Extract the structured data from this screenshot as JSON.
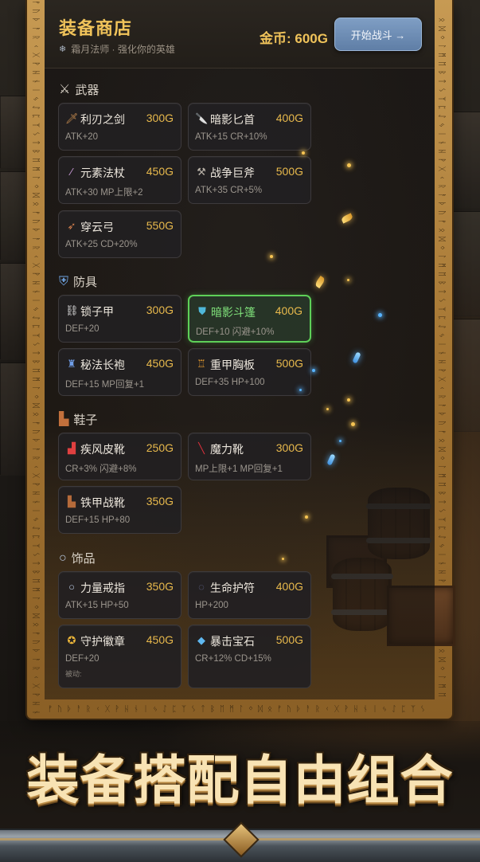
{
  "header": {
    "title": "装备商店",
    "subtitle": "霜月法师 · 强化你的英雄",
    "gold": "金币: 600G",
    "start_button": "开始战斗 →"
  },
  "sections": {
    "weapons": {
      "title": "武器",
      "icon": "crossed-swords-icon",
      "items": [
        {
          "name": "利刃之剑",
          "price": "300G",
          "stats": "ATK+20",
          "icon": "sword-icon"
        },
        {
          "name": "暗影匕首",
          "price": "400G",
          "stats": "ATK+15 CR+10%",
          "icon": "dagger-icon"
        },
        {
          "name": "元素法杖",
          "price": "450G",
          "stats": "ATK+30 MP上限+2",
          "icon": "wand-icon"
        },
        {
          "name": "战争巨斧",
          "price": "500G",
          "stats": "ATK+35 CR+5%",
          "icon": "axe-icon"
        },
        {
          "name": "穿云弓",
          "price": "550G",
          "stats": "ATK+25 CD+20%",
          "icon": "bow-icon"
        }
      ]
    },
    "armor": {
      "title": "防具",
      "icon": "shield-icon",
      "items": [
        {
          "name": "锁子甲",
          "price": "300G",
          "stats": "DEF+20",
          "icon": "chainmail-icon"
        },
        {
          "name": "暗影斗篷",
          "price": "400G",
          "stats": "DEF+10 闪避+10%",
          "icon": "cloak-icon",
          "selected": true
        },
        {
          "name": "秘法长袍",
          "price": "450G",
          "stats": "DEF+15 MP回复+1",
          "icon": "robe-icon"
        },
        {
          "name": "重甲胸板",
          "price": "500G",
          "stats": "DEF+35 HP+100",
          "icon": "breastplate-icon"
        }
      ]
    },
    "boots": {
      "title": "鞋子",
      "icon": "boot-icon",
      "items": [
        {
          "name": "疾风皮靴",
          "price": "250G",
          "stats": "CR+3% 闪避+8%",
          "icon": "sneaker-icon"
        },
        {
          "name": "魔力靴",
          "price": "300G",
          "stats": "MP上限+1 MP回复+1",
          "icon": "high-heel-icon"
        },
        {
          "name": "铁甲战靴",
          "price": "350G",
          "stats": "DEF+15 HP+80",
          "icon": "iron-boot-icon"
        }
      ]
    },
    "accessories": {
      "title": "饰品",
      "icon": "ring-icon",
      "items": [
        {
          "name": "力量戒指",
          "price": "350G",
          "stats": "ATK+15 HP+50",
          "icon": "ring-icon"
        },
        {
          "name": "生命护符",
          "price": "400G",
          "stats": "HP+200",
          "icon": "amulet-icon"
        },
        {
          "name": "守护徽章",
          "price": "450G",
          "stats": "DEF+20",
          "extra": "被动:",
          "icon": "medal-icon"
        },
        {
          "name": "暴击宝石",
          "price": "500G",
          "stats": "CR+12% CD+15%",
          "icon": "gem-icon"
        }
      ]
    }
  },
  "banner": "装备搭配自由组合",
  "colors": {
    "gold": "#f0c35a",
    "price": "#e8b94c",
    "selected_border": "#5ed058",
    "button": "#6f8fb8"
  }
}
